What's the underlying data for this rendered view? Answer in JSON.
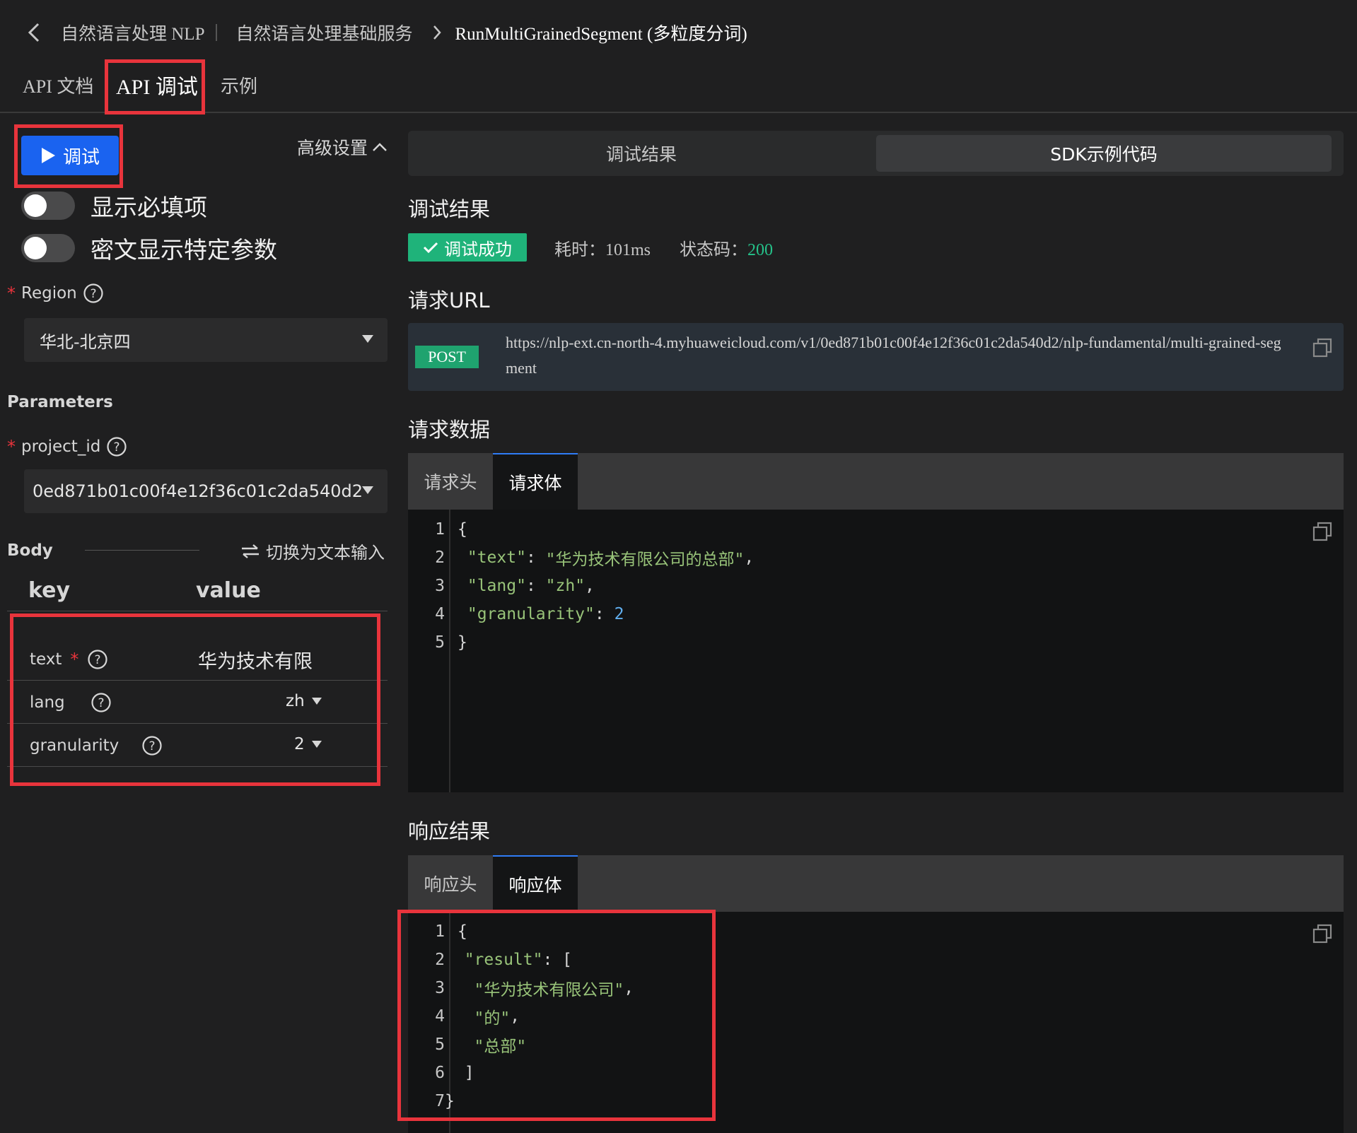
{
  "breadcrumb": {
    "items": [
      "自然语言处理 NLP",
      "自然语言处理基础服务",
      "RunMultiGrainedSegment (多粒度分词)"
    ]
  },
  "tabs": [
    {
      "label": "API 文档"
    },
    {
      "label": "API 调试"
    },
    {
      "label": "示例"
    }
  ],
  "left": {
    "run_label": "调试",
    "advanced_label": "高级设置",
    "toggles": [
      {
        "label": "显示必填项",
        "on": false
      },
      {
        "label": "密文显示特定参数",
        "on": false
      }
    ],
    "region": {
      "label": "Region",
      "value": "华北-北京四"
    },
    "parameters_title": "Parameters",
    "project": {
      "label": "project_id",
      "value": "0ed871b01c00f4e12f36c01c2da540d2"
    },
    "body_title": "Body",
    "switch_label": "切换为文本输入",
    "kv_headers": {
      "key": "key",
      "value": "value"
    },
    "rows": [
      {
        "key": "text",
        "value": "华为技术有限"
      },
      {
        "key": "lang",
        "value": "zh"
      },
      {
        "key": "granularity",
        "value": "2"
      }
    ]
  },
  "right": {
    "segments": [
      "调试结果",
      "SDK示例代码"
    ],
    "result_title": "调试结果",
    "status_badge": "调试成功",
    "time_label": "耗时：",
    "time_value": "101ms",
    "code_label": "状态码：",
    "code_value": "200",
    "url_title": "请求URL",
    "method": "POST",
    "url": "https://nlp-ext.cn-north-4.myhuaweicloud.com/v1/0ed871b01c00f4e12f36c01c2da540d2/nlp-fundamental/multi-grained-segment",
    "request_title": "请求数据",
    "request_tabs": [
      "请求头",
      "请求体"
    ],
    "request_lines": [
      {
        "n": "1",
        "a": "{",
        "b": "",
        "c": ""
      },
      {
        "n": "2",
        "a": " ",
        "b": "\"text\"",
        "c": ": ",
        "d": "\"华为技术有限公司的总部\"",
        "e": ","
      },
      {
        "n": "3",
        "a": " ",
        "b": "\"lang\"",
        "c": ": ",
        "d": "\"zh\"",
        "e": ","
      },
      {
        "n": "4",
        "a": " ",
        "b": "\"granularity\"",
        "c": ": ",
        "num": "2"
      },
      {
        "n": "5",
        "a": "}",
        "b": "",
        "c": ""
      }
    ],
    "response_title": "响应结果",
    "response_tabs": [
      "响应头",
      "响应体"
    ],
    "response_lines": [
      {
        "n": "1",
        "t": "{"
      },
      {
        "n": "2",
        "t": "  \"result\"",
        "u": ": ["
      },
      {
        "n": "3",
        "t": "   \"华为技术有限公司\"",
        "u": ","
      },
      {
        "n": "4",
        "t": "   \"的\"",
        "u": ","
      },
      {
        "n": "5",
        "t": "   \"总部\"",
        "u": ""
      },
      {
        "n": "6",
        "t": "  ]"
      },
      {
        "n": "7",
        "t": "}"
      }
    ]
  }
}
